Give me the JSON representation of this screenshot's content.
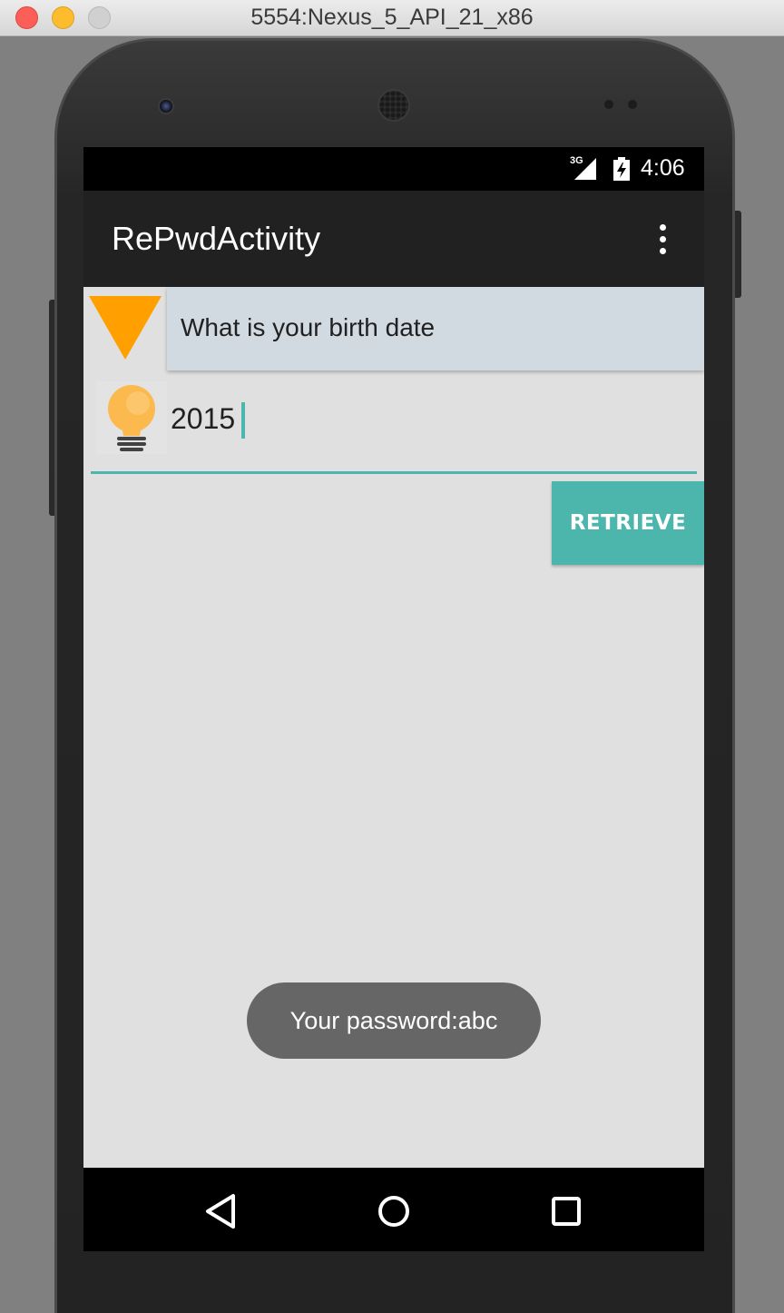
{
  "window": {
    "title": "5554:Nexus_5_API_21_x86"
  },
  "status_bar": {
    "network": "3G",
    "time": "4:06"
  },
  "action_bar": {
    "title": "RePwdActivity",
    "overflow_icon": "more-vert-icon"
  },
  "form": {
    "question_spinner": {
      "selected": "What is your birth date"
    },
    "answer_input": {
      "value": "2015",
      "icon": "lightbulb-icon"
    },
    "retrieve_button": {
      "label": "RETRIEVE"
    }
  },
  "toast": {
    "message": "Your password:abc"
  },
  "nav_bar": {
    "icons": [
      "back-icon",
      "home-icon",
      "recents-icon"
    ]
  },
  "colors": {
    "accent": "#4db6ac",
    "action_bar": "#212121",
    "spinner_bg": "#d1d9e1",
    "spinner_arrow": "#ffa000",
    "toast_bg": "#666666"
  }
}
